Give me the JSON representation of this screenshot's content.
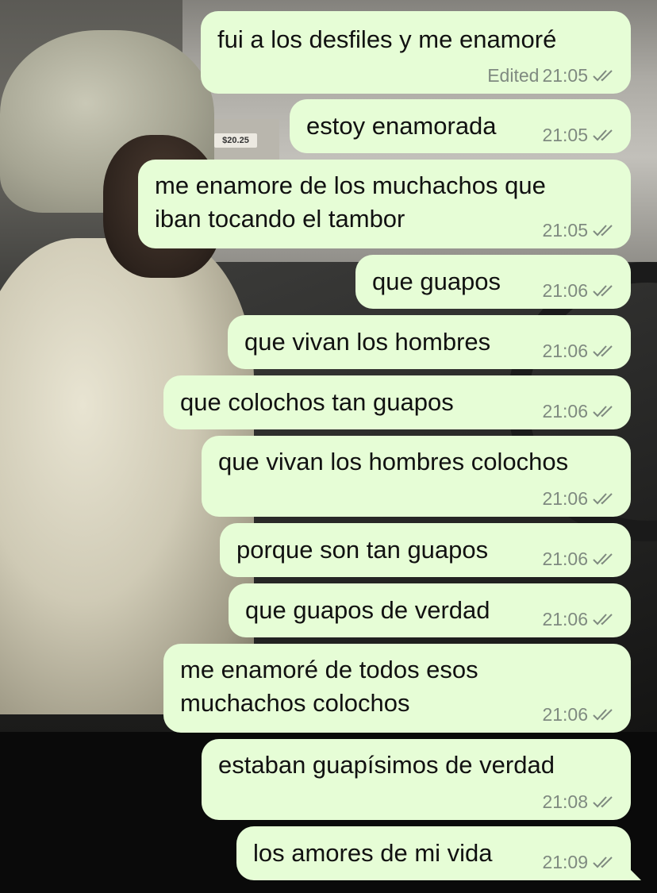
{
  "background": {
    "description_color": "#0a0a0a",
    "sign_text": "$20.25"
  },
  "colors": {
    "bubble": "#e6fdd6",
    "meta_text": "#7f8a80",
    "message_text": "#111111"
  },
  "messages": [
    {
      "text": "fui a los desfiles y me enamoré",
      "edited_label": "Edited",
      "time": "21:05",
      "status_icon": "double-check-icon"
    },
    {
      "text": "estoy enamorada",
      "time": "21:05",
      "status_icon": "double-check-icon"
    },
    {
      "text": "me enamore de los muchachos que iban tocando el tambor",
      "time": "21:05",
      "status_icon": "double-check-icon"
    },
    {
      "text": "que guapos",
      "time": "21:06",
      "status_icon": "double-check-icon"
    },
    {
      "text": "que vivan los hombres",
      "time": "21:06",
      "status_icon": "double-check-icon"
    },
    {
      "text": "que colochos tan guapos",
      "time": "21:06",
      "status_icon": "double-check-icon"
    },
    {
      "text": "que vivan los hombres colochos",
      "time": "21:06",
      "status_icon": "double-check-icon"
    },
    {
      "text": "porque son tan guapos",
      "time": "21:06",
      "status_icon": "double-check-icon"
    },
    {
      "text": "que guapos de verdad",
      "time": "21:06",
      "status_icon": "double-check-icon"
    },
    {
      "text": "me enamoré de todos esos muchachos colochos",
      "time": "21:06",
      "status_icon": "double-check-icon"
    },
    {
      "text": "estaban guapísimos de verdad",
      "time": "21:08",
      "status_icon": "double-check-icon"
    },
    {
      "text": "los amores de mi vida",
      "time": "21:09",
      "status_icon": "double-check-icon"
    }
  ]
}
